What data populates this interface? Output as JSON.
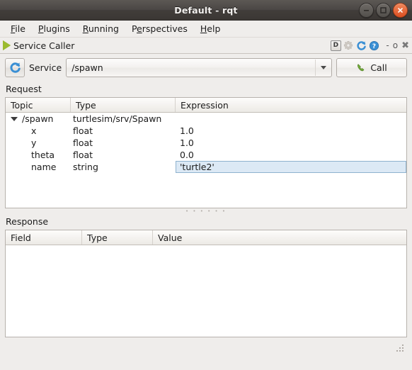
{
  "window": {
    "title": "Default - rqt",
    "buttons": {
      "minimize": "minimize-icon",
      "maximize": "maximize-icon",
      "close": "close-icon"
    }
  },
  "menubar": {
    "items": [
      {
        "label": "File",
        "mnemonic": "F",
        "rest": "ile"
      },
      {
        "label": "Plugins",
        "mnemonic": "P",
        "rest": "lugins"
      },
      {
        "label": "Running",
        "mnemonic": "R",
        "rest": "unning"
      },
      {
        "label": "Perspectives",
        "pre": "P",
        "mnemonic": "e",
        "rest": "rspectives"
      },
      {
        "label": "Help",
        "mnemonic": "H",
        "rest": "elp"
      }
    ]
  },
  "plugin": {
    "title": "Service Caller",
    "title_icon": "green-play-triangle-icon",
    "tools": [
      {
        "name": "dock-toggle-button",
        "label": "D"
      },
      {
        "name": "settings-gear-icon",
        "label": ""
      },
      {
        "name": "reload-plugin-icon",
        "label": ""
      },
      {
        "name": "help-icon",
        "label": ""
      }
    ],
    "system_buttons": {
      "minimize": "-",
      "maximize": "o",
      "close": "✖"
    }
  },
  "service_bar": {
    "refresh_icon": "refresh-icon",
    "label": "Service",
    "selected_service": "/spawn",
    "placeholder": "/spawn",
    "call_button": "Call",
    "call_icon": "phone-icon"
  },
  "request": {
    "section_label": "Request",
    "columns": [
      "Topic",
      "Type",
      "Expression"
    ],
    "rows": [
      {
        "topic": "/spawn",
        "type": "turtlesim/srv/Spawn",
        "expression": "",
        "level": 0,
        "expanded": true
      },
      {
        "topic": "x",
        "type": "float",
        "expression": "1.0",
        "level": 1
      },
      {
        "topic": "y",
        "type": "float",
        "expression": "1.0",
        "level": 1
      },
      {
        "topic": "theta",
        "type": "float",
        "expression": "0.0",
        "level": 1
      },
      {
        "topic": "name",
        "type": "string",
        "expression": "'turtle2'",
        "level": 1,
        "editing": true
      }
    ]
  },
  "response": {
    "section_label": "Response",
    "columns": [
      "Field",
      "Type",
      "Value"
    ],
    "rows": []
  },
  "colors": {
    "titlebar": "#4b4745",
    "close_button": "#dc4f21",
    "window_bg": "#efedeb",
    "selection": "#dce9f5",
    "accent_green": "#9bbb2f",
    "accent_blue": "#3a7fc1"
  }
}
